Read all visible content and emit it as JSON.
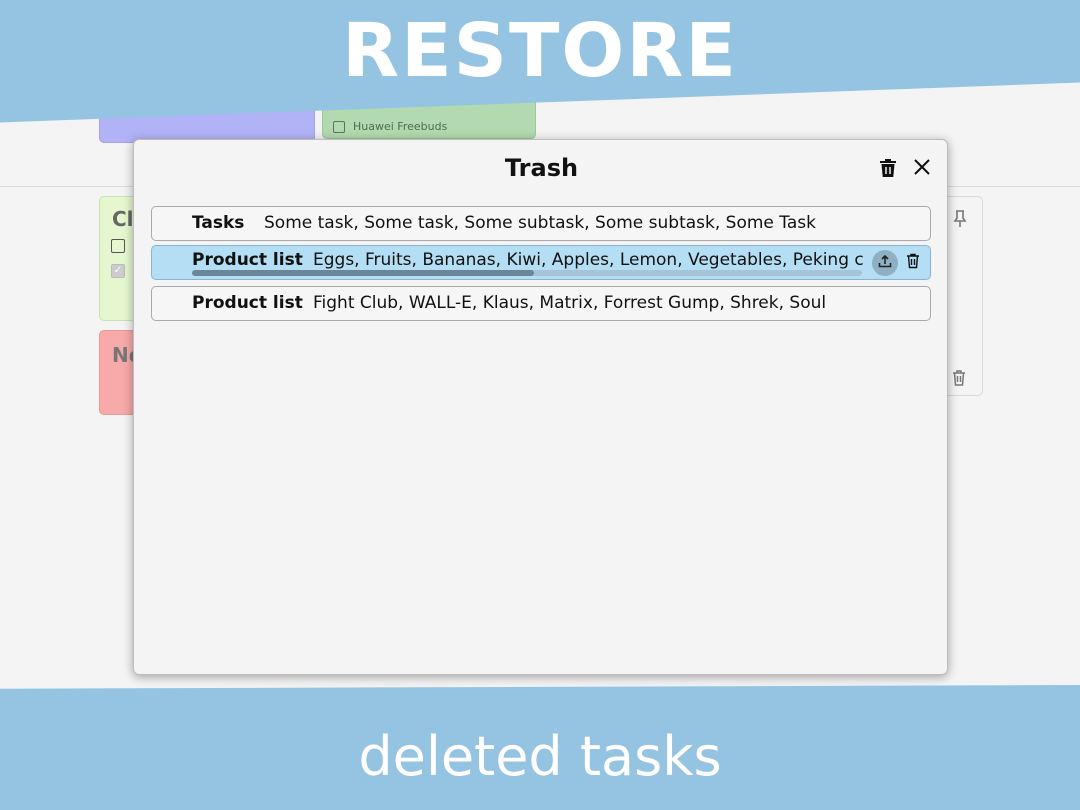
{
  "banner": {
    "top_text": "RESTORE",
    "bottom_text": "deleted tasks"
  },
  "background": {
    "green_top_card": {
      "item": "Huawei Freebuds"
    },
    "green_card": {
      "title": "Cl"
    },
    "red_card": {
      "title": "No"
    }
  },
  "dialog": {
    "title": "Trash",
    "items": [
      {
        "name": "Tasks",
        "content": "Some task, Some task, Some subtask, Some subtask, Some Task"
      },
      {
        "name": "Product list",
        "content": "Eggs, Fruits, Bananas, Kiwi, Apples, Lemon, Vegetables, Peking cabbage"
      },
      {
        "name": "Product list",
        "content": "Fight Club, WALL-E, Klaus, Matrix, Forrest Gump, Shrek, Soul"
      }
    ],
    "selected_item_scroll_fraction": 0.51
  },
  "colors": {
    "banner": "#95c4e2",
    "selected_row": "#b4def4"
  }
}
